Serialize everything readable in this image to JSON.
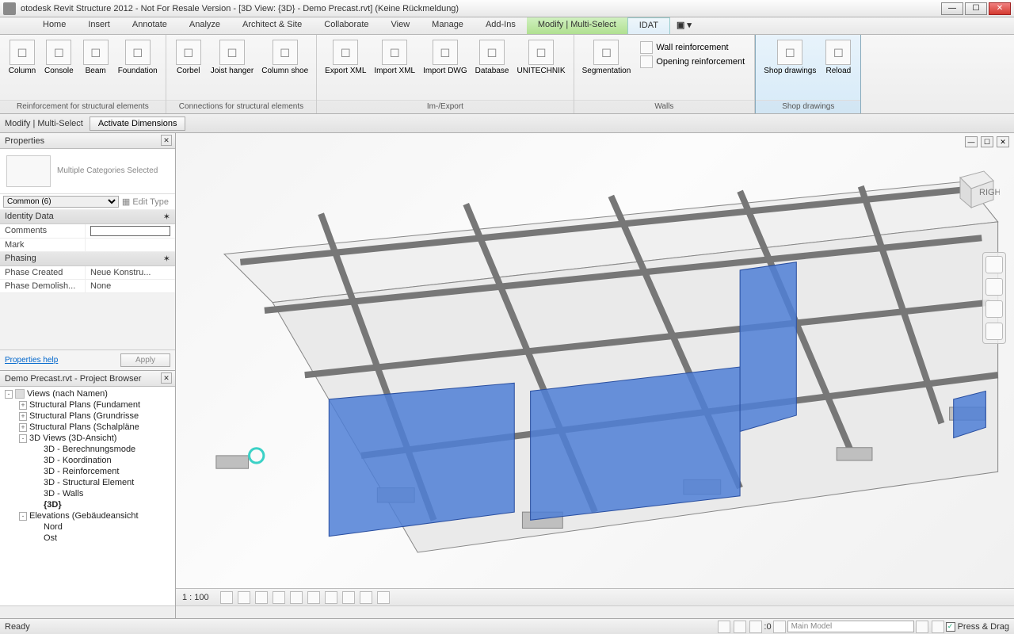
{
  "window": {
    "title": "otodesk Revit Structure 2012 - Not For Resale Version - [3D View: {3D} - Demo Precast.rvt] (Keine Rückmeldung)"
  },
  "menubar": {
    "tabs": [
      "Home",
      "Insert",
      "Annotate",
      "Analyze",
      "Architect & Site",
      "Collaborate",
      "View",
      "Manage",
      "Add-Ins",
      "Modify | Multi-Select",
      "IDAT"
    ],
    "special_index": 9,
    "active_index": 10
  },
  "ribbon": {
    "groups": [
      {
        "label": "Reinforcement for structural elements",
        "items": [
          {
            "label": "Column"
          },
          {
            "label": "Console"
          },
          {
            "label": "Beam"
          },
          {
            "label": "Foundation"
          }
        ]
      },
      {
        "label": "Connections for structural elements",
        "items": [
          {
            "label": "Corbel"
          },
          {
            "label": "Joist hanger"
          },
          {
            "label": "Column shoe"
          }
        ]
      },
      {
        "label": "Im-/Export",
        "items": [
          {
            "label": "Export XML"
          },
          {
            "label": "Import XML"
          },
          {
            "label": "Import DWG"
          },
          {
            "label": "Database"
          },
          {
            "label": "UNITECHNIK"
          }
        ]
      },
      {
        "label": "Walls",
        "items": [
          {
            "label": "Segmentation"
          }
        ],
        "inline": [
          {
            "label": "Wall reinforcement"
          },
          {
            "label": "Opening reinforcement"
          }
        ]
      },
      {
        "label": "Shop drawings",
        "selected": true,
        "items": [
          {
            "label": "Shop drawings"
          },
          {
            "label": "Reload"
          }
        ]
      }
    ]
  },
  "optionsbar": {
    "context": "Modify | Multi-Select",
    "button": "Activate Dimensions"
  },
  "properties": {
    "title": "Properties",
    "type_hint": "Multiple Categories Selected",
    "selector": "Common (6)",
    "edit_type": "Edit Type",
    "groups": [
      {
        "header": "Identity Data",
        "rows": [
          {
            "k": "Comments",
            "v": "",
            "input": true
          },
          {
            "k": "Mark",
            "v": ""
          }
        ]
      },
      {
        "header": "Phasing",
        "rows": [
          {
            "k": "Phase Created",
            "v": "Neue Konstru..."
          },
          {
            "k": "Phase Demolish...",
            "v": "None"
          }
        ]
      }
    ],
    "help": "Properties help",
    "apply": "Apply"
  },
  "browser": {
    "title": "Demo Precast.rvt - Project Browser",
    "tree": [
      {
        "lvl": 0,
        "tw": "-",
        "ico": true,
        "label": "Views (nach Namen)"
      },
      {
        "lvl": 1,
        "tw": "+",
        "label": "Structural Plans (Fundament"
      },
      {
        "lvl": 1,
        "tw": "+",
        "label": "Structural Plans (Grundrisse"
      },
      {
        "lvl": 1,
        "tw": "+",
        "label": "Structural Plans (Schalpläne"
      },
      {
        "lvl": 1,
        "tw": "-",
        "label": "3D Views (3D-Ansicht)"
      },
      {
        "lvl": 2,
        "label": "3D - Berechnungsmode"
      },
      {
        "lvl": 2,
        "label": "3D - Koordination"
      },
      {
        "lvl": 2,
        "label": "3D - Reinforcement"
      },
      {
        "lvl": 2,
        "label": "3D - Structural Element"
      },
      {
        "lvl": 2,
        "label": "3D - Walls"
      },
      {
        "lvl": 2,
        "label": "{3D}",
        "bold": true
      },
      {
        "lvl": 1,
        "tw": "-",
        "label": "Elevations (Gebäudeansicht"
      },
      {
        "lvl": 2,
        "label": "Nord"
      },
      {
        "lvl": 2,
        "label": "Ost"
      }
    ]
  },
  "view": {
    "scale": "1 : 100",
    "cube_face": "RIGHT"
  },
  "statusbar": {
    "msg": "Ready",
    "zero": ":0",
    "workset": "Main Model",
    "pressdrag": "Press & Drag"
  }
}
